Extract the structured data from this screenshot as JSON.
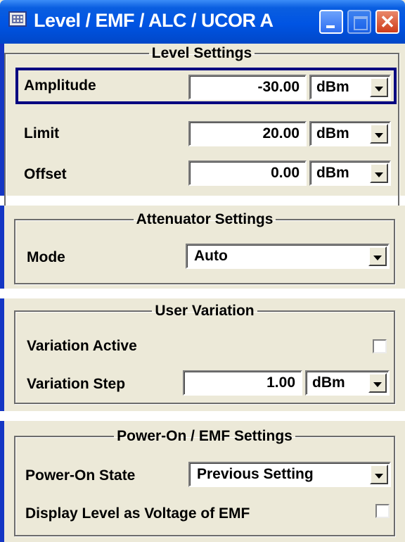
{
  "window": {
    "title": "Level / EMF / ALC / UCOR A"
  },
  "level_settings": {
    "legend": "Level Settings",
    "rows": [
      {
        "label": "Amplitude",
        "value": "-30.00",
        "unit": "dBm"
      },
      {
        "label": "Limit",
        "value": "20.00",
        "unit": "dBm"
      },
      {
        "label": "Offset",
        "value": "0.00",
        "unit": "dBm"
      }
    ]
  },
  "attenuator_settings": {
    "legend": "Attenuator Settings",
    "mode_label": "Mode",
    "mode_value": "Auto"
  },
  "user_variation": {
    "legend": "User Variation",
    "active_label": "Variation Active",
    "active_checked": false,
    "step_label": "Variation Step",
    "step_value": "1.00",
    "step_unit": "dBm"
  },
  "power_on": {
    "legend": "Power-On / EMF Settings",
    "state_label": "Power-On State",
    "state_value": "Previous Setting",
    "display_label": "Display Level as Voltage of EMF",
    "display_checked": false
  },
  "colors": {
    "title_bar": "#0054e3",
    "panel_bg": "#ece9d8",
    "focus": "#000080"
  }
}
